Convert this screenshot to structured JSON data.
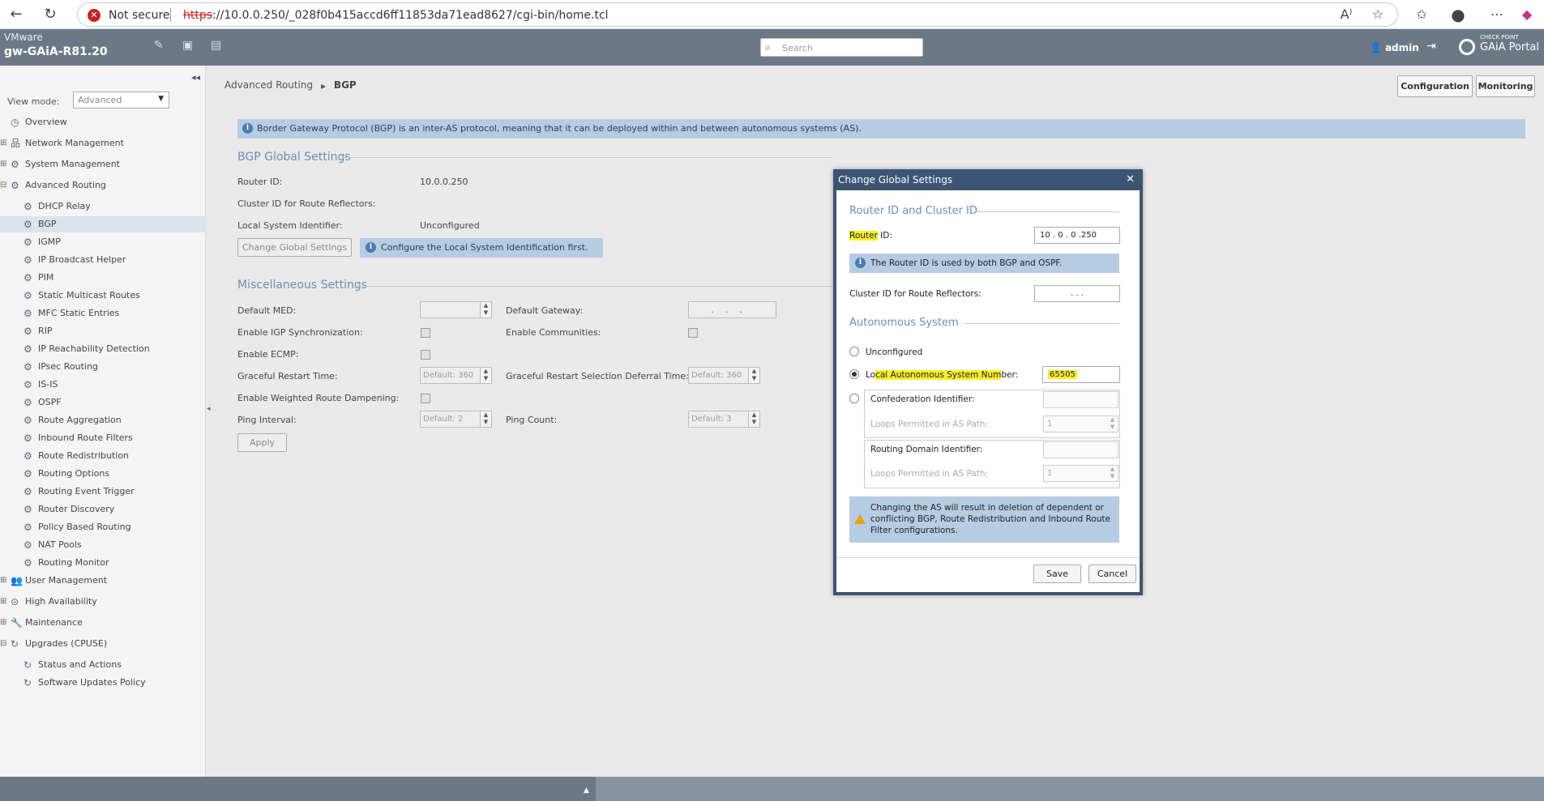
{
  "browser": {
    "not_secure": "Not secure",
    "url_proto": "https",
    "url_rest": "://10.0.0.250/_028f0b415accd6ff11853da71ead8627/cgi-bin/home.tcl"
  },
  "header": {
    "vendor": "VMware",
    "hostname": "gw-GAiA-R81.20",
    "search_placeholder": "Search",
    "user": "admin",
    "brand_small": "CHECK POINT",
    "brand": "GAiA Portal"
  },
  "sidebar": {
    "view_mode_label": "View mode:",
    "view_mode_value": "Advanced",
    "items": [
      {
        "label": "Overview",
        "level": 0,
        "exp": ""
      },
      {
        "label": "Network Management",
        "level": 0,
        "exp": "+"
      },
      {
        "label": "System Management",
        "level": 0,
        "exp": "+"
      },
      {
        "label": "Advanced Routing",
        "level": 0,
        "exp": "−"
      },
      {
        "label": "DHCP Relay",
        "level": 1
      },
      {
        "label": "BGP",
        "level": 1,
        "selected": true
      },
      {
        "label": "IGMP",
        "level": 1
      },
      {
        "label": "IP Broadcast Helper",
        "level": 1
      },
      {
        "label": "PIM",
        "level": 1
      },
      {
        "label": "Static Multicast Routes",
        "level": 1
      },
      {
        "label": "MFC Static Entries",
        "level": 1
      },
      {
        "label": "RIP",
        "level": 1
      },
      {
        "label": "IP Reachability Detection",
        "level": 1
      },
      {
        "label": "IPsec Routing",
        "level": 1
      },
      {
        "label": "IS-IS",
        "level": 1
      },
      {
        "label": "OSPF",
        "level": 1
      },
      {
        "label": "Route Aggregation",
        "level": 1
      },
      {
        "label": "Inbound Route Filters",
        "level": 1
      },
      {
        "label": "Route Redistribution",
        "level": 1
      },
      {
        "label": "Routing Options",
        "level": 1
      },
      {
        "label": "Routing Event Trigger",
        "level": 1
      },
      {
        "label": "Router Discovery",
        "level": 1
      },
      {
        "label": "Policy Based Routing",
        "level": 1
      },
      {
        "label": "NAT Pools",
        "level": 1
      },
      {
        "label": "Routing Monitor",
        "level": 1
      },
      {
        "label": "User Management",
        "level": 0,
        "exp": "+"
      },
      {
        "label": "High Availability",
        "level": 0,
        "exp": "+"
      },
      {
        "label": "Maintenance",
        "level": 0,
        "exp": "+"
      },
      {
        "label": "Upgrades (CPUSE)",
        "level": 0,
        "exp": "−"
      },
      {
        "label": "Status and Actions",
        "level": 1
      },
      {
        "label": "Software Updates Policy",
        "level": 1
      }
    ]
  },
  "main": {
    "breadcrumb_parent": "Advanced Routing",
    "breadcrumb_current": "BGP",
    "tab_configuration": "Configuration",
    "tab_monitoring": "Monitoring",
    "info": "Border Gateway Protocol (BGP) is an inter-AS protocol, meaning that it can be deployed within and between autonomous systems (AS).",
    "global_title": "BGP Global Settings",
    "router_id_label": "Router ID:",
    "router_id_value": "10.0.0.250",
    "cluster_label": "Cluster ID for Route Reflectors:",
    "local_sys_label": "Local System Identifier:",
    "local_sys_value": "Unconfigured",
    "change_btn": "Change Global Settings",
    "change_hint": "Configure the Local System Identification first.",
    "misc_title": "Miscellaneous Settings",
    "default_med": "Default MED:",
    "default_gw": "Default Gateway:",
    "igp_sync": "Enable IGP Synchronization:",
    "communities": "Enable Communities:",
    "ecmp": "Enable ECMP:",
    "graceful": "Graceful Restart Time:",
    "graceful_ph": "Default: 360",
    "graceful_sel": "Graceful Restart Selection Deferral Time:",
    "graceful_sel_ph": "Default: 360",
    "dampening": "Enable Weighted Route Dampening:",
    "ping_interval": "Ping Interval:",
    "ping_interval_ph": "Default: 2",
    "ping_count": "Ping Count:",
    "ping_count_ph": "Default: 3",
    "apply": "Apply"
  },
  "dialog": {
    "title": "Change Global Settings",
    "sect_router": "Router ID and Cluster ID",
    "router_id_hl": "Router",
    "router_id_rest": " ID:",
    "router_id": "10 .  0  .  0  .250",
    "router_info": "The Router ID is used by both BGP and OSPF.",
    "cluster_label": "Cluster ID for Route Reflectors:",
    "cluster_value": ".      .      .",
    "sect_as": "Autonomous System",
    "unconfigured": "Unconfigured",
    "local_as_pre": "Lo",
    "local_as_hl": "cal Autonomous System Num",
    "local_as_post": "ber:",
    "local_as_value": "65505",
    "confed_label": "Confederation Identifier:",
    "loops_label_1": "Loops Permitted in AS Path:",
    "loops_value_1": "1",
    "routing_domain_label": "Routing Domain Identifier:",
    "loops_label_2": "Loops Permitted in AS Path:",
    "loops_value_2": "1",
    "warning": "Changing the AS will result in deletion of dependent or conflicting BGP, Route Redistribution and Inbound Route Filter configurations.",
    "save": "Save",
    "cancel": "Cancel"
  }
}
